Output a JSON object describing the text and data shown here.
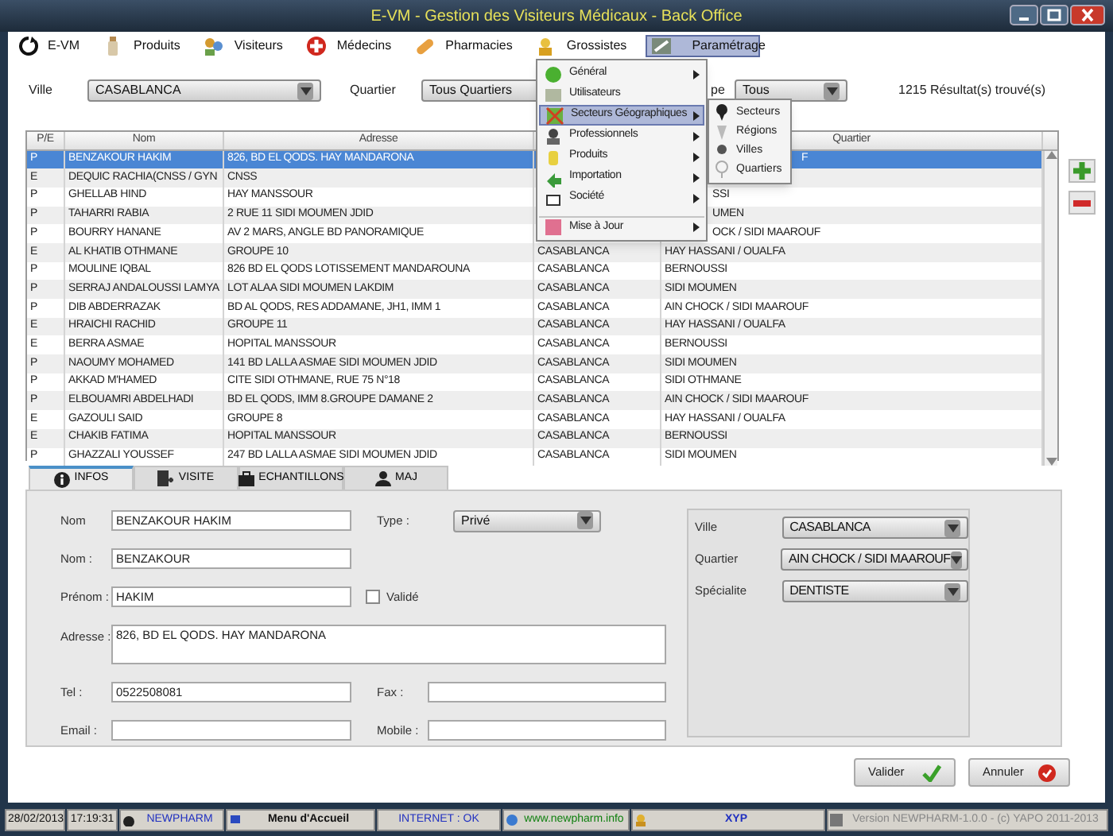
{
  "window": {
    "title": "E-VM - Gestion des Visiteurs Médicaux - Back Office"
  },
  "menu_bar": [
    {
      "label": "E-VM",
      "selected": false
    },
    {
      "label": "Produits",
      "selected": false
    },
    {
      "label": "Visiteurs",
      "selected": false
    },
    {
      "label": "Médecins",
      "selected": false
    },
    {
      "label": "Pharmacies",
      "selected": false
    },
    {
      "label": "Grossistes",
      "selected": false
    },
    {
      "label": "Paramétrage",
      "selected": true
    }
  ],
  "dropdown_menu": [
    {
      "label": "Général",
      "submenu": true,
      "selected": false
    },
    {
      "label": "Utilisateurs",
      "submenu": false,
      "selected": false
    },
    {
      "label": "Secteurs Géographiques",
      "submenu": true,
      "selected": true
    },
    {
      "label": "Professionnels",
      "submenu": true,
      "selected": false
    },
    {
      "label": "Produits",
      "submenu": true,
      "selected": false
    },
    {
      "label": "Importation",
      "submenu": true,
      "selected": false
    },
    {
      "label": "Société",
      "submenu": true,
      "selected": false
    },
    {
      "label": "Mise à Jour",
      "submenu": true,
      "selected": false,
      "separator_before": true
    }
  ],
  "submenu": [
    {
      "label": "Secteurs"
    },
    {
      "label": "Régions"
    },
    {
      "label": "Villes"
    },
    {
      "label": "Quartiers"
    }
  ],
  "filters": {
    "ville_label": "Ville",
    "ville_value": "CASABLANCA",
    "quartier_label": "Quartier",
    "quartier_value": "Tous Quartiers",
    "type_label": "pe",
    "type_value": "Tous",
    "result_count": "1215 Résultat(s) trouvé(s)"
  },
  "table": {
    "columns": [
      {
        "label": "P/E"
      },
      {
        "label": "Nom"
      },
      {
        "label": "Adresse"
      },
      {},
      {
        "label": "Quartier"
      }
    ],
    "rows": [
      {
        "pe": "P",
        "nom": "BENZAKOUR HAKIM",
        "adresse": "826, BD EL QODS. HAY MANDARONA",
        "quartier": "F",
        "selected": true
      },
      {
        "pe": "E",
        "nom": "DEQUIC RACHIA(CNSS / GYN",
        "adresse": "CNSS",
        "selected": false
      },
      {
        "pe": "P",
        "nom": "GHELLAB HIND",
        "adresse": "HAY MANSSOUR",
        "quartier": "SSI",
        "selected": false
      },
      {
        "pe": "P",
        "nom": "TAHARRI RABIA",
        "adresse": "2 RUE 11 SIDI MOUMEN JDID",
        "quartier": "UMEN",
        "selected": false
      },
      {
        "pe": "P",
        "nom": "BOURRY HANANE",
        "adresse": "AV 2 MARS, ANGLE BD PANORAMIQUE",
        "quartier": "OCK / SIDI MAAROUF",
        "selected": false
      },
      {
        "pe": "E",
        "nom": "AL KHATIB OTHMANE",
        "adresse": "GROUPE 10",
        "ville": "CASABLANCA",
        "quartier": "HAY HASSANI / OUALFA",
        "selected": false
      },
      {
        "pe": "P",
        "nom": "MOULINE IQBAL",
        "adresse": "826 BD EL QODS LOTISSEMENT MANDAROUNA",
        "ville": "CASABLANCA",
        "quartier": "BERNOUSSI",
        "selected": false
      },
      {
        "pe": "P",
        "nom": "SERRAJ ANDALOUSSI LAMYA",
        "adresse": "LOT ALAA SIDI MOUMEN LAKDIM",
        "ville": "CASABLANCA",
        "quartier": "SIDI MOUMEN",
        "selected": false
      },
      {
        "pe": "P",
        "nom": "DIB ABDERRAZAK",
        "adresse": "BD AL QODS, RES ADDAMANE, JH1, IMM 1",
        "ville": "CASABLANCA",
        "quartier": "AIN CHOCK / SIDI MAAROUF",
        "selected": false
      },
      {
        "pe": "E",
        "nom": "HRAICHI RACHID",
        "adresse": "GROUPE 11",
        "ville": "CASABLANCA",
        "quartier": "HAY HASSANI / OUALFA",
        "selected": false
      },
      {
        "pe": "E",
        "nom": "BERRA ASMAE",
        "adresse": "HOPITAL MANSSOUR",
        "ville": "CASABLANCA",
        "quartier": "BERNOUSSI",
        "selected": false
      },
      {
        "pe": "P",
        "nom": "NAOUMY MOHAMED",
        "adresse": "141 BD LALLA ASMAE SIDI MOUMEN JDID",
        "ville": "CASABLANCA",
        "quartier": "SIDI MOUMEN",
        "selected": false
      },
      {
        "pe": "P",
        "nom": "AKKAD M'HAMED",
        "adresse": "CITE SIDI OTHMANE, RUE 75 N°18",
        "ville": "CASABLANCA",
        "quartier": "SIDI OTHMANE",
        "selected": false
      },
      {
        "pe": "P",
        "nom": "ELBOUAMRI ABDELHADI",
        "adresse": "BD EL QODS, IMM 8.GROUPE DAMANE 2",
        "ville": "CASABLANCA",
        "quartier": "AIN CHOCK / SIDI MAAROUF",
        "selected": false
      },
      {
        "pe": "E",
        "nom": "GAZOULI SAID",
        "adresse": "GROUPE 8",
        "ville": "CASABLANCA",
        "quartier": "HAY HASSANI / OUALFA",
        "selected": false
      },
      {
        "pe": "E",
        "nom": "CHAKIB FATIMA",
        "adresse": "HOPITAL MANSSOUR",
        "ville": "CASABLANCA",
        "quartier": "BERNOUSSI",
        "selected": false
      },
      {
        "pe": "P",
        "nom": "GHAZZALI YOUSSEF",
        "adresse": "247 BD LALLA ASMAE SIDI MOUMEN JDID",
        "ville": "CASABLANCA",
        "quartier": "SIDI MOUMEN",
        "selected": false
      }
    ]
  },
  "tabs": [
    {
      "label": "INFOS",
      "selected": true
    },
    {
      "label": "VISITE",
      "selected": false
    },
    {
      "label": "ECHANTILLONS",
      "selected": false
    },
    {
      "label": "MAJ",
      "selected": false
    }
  ],
  "form": {
    "nom_complet": {
      "label": "Nom",
      "value": "BENZAKOUR HAKIM"
    },
    "type": {
      "label": "Type :",
      "value": "Privé"
    },
    "nom": {
      "label": "Nom :",
      "value": "BENZAKOUR"
    },
    "prenom": {
      "label": "Prénom :",
      "value": "HAKIM"
    },
    "valide": {
      "label": "Validé",
      "checked": false
    },
    "adresse": {
      "label": "Adresse :",
      "value": "826, BD EL QODS. HAY MANDARONA"
    },
    "tel": {
      "label": "Tel :",
      "value": "0522508081"
    },
    "fax": {
      "label": "Fax :"
    },
    "email": {
      "label": "Email :"
    },
    "mobile": {
      "label": "Mobile :"
    },
    "ville": {
      "label": "Ville",
      "value": "CASABLANCA"
    },
    "quartier": {
      "label": "Quartier",
      "value": "AIN CHOCK / SIDI MAAROUF"
    },
    "specialite": {
      "label": "Spécialite",
      "value": "DENTISTE"
    }
  },
  "buttons": [
    {
      "label": "Valider",
      "kind": "ok"
    },
    {
      "label": "Annuler",
      "kind": "cancel"
    }
  ],
  "status_bar": [
    {
      "text": "28/02/2013"
    },
    {
      "text": "17:19:31"
    },
    {
      "text": "NEWPHARM"
    },
    {
      "text": "Menu d'Accueil"
    },
    {
      "text": "INTERNET : OK"
    },
    {
      "text": "www.newpharm.info"
    },
    {
      "text": "XYP"
    },
    {
      "text": "Version NEWPHARM-1.0.0 - (c) YAPO 2011-2013"
    }
  ]
}
